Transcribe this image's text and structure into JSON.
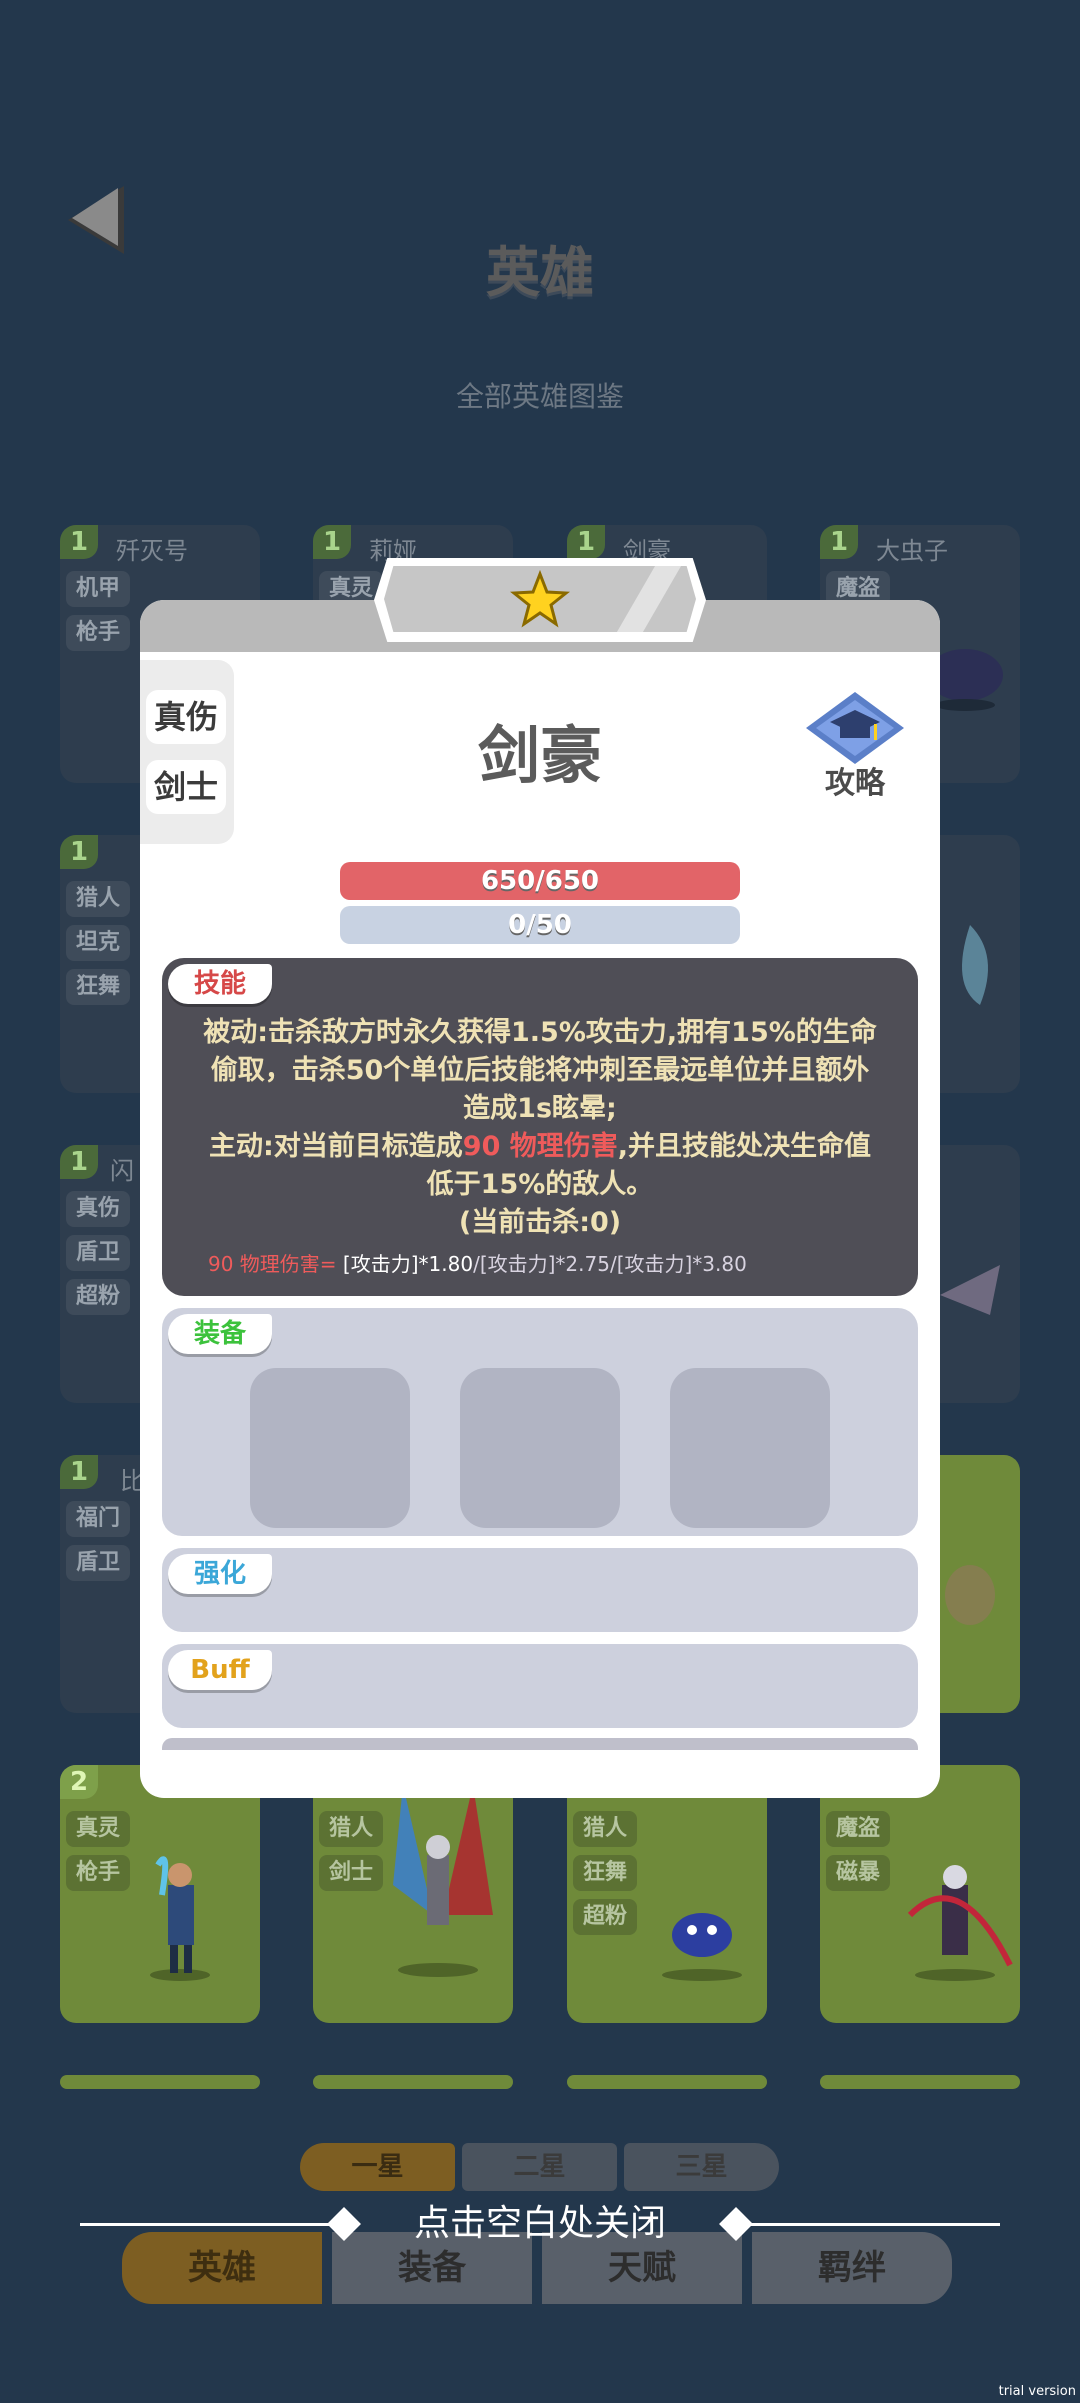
{
  "page": {
    "title": "英雄",
    "subtitle": "全部英雄图鉴"
  },
  "heroes_top": [
    {
      "level": "1",
      "name": "歼灭号",
      "tags": [
        "机甲",
        "枪手"
      ]
    },
    {
      "level": "1",
      "name": "莉娅",
      "tags": [
        "真灵"
      ]
    },
    {
      "level": "1",
      "name": "剑豪",
      "tags": []
    },
    {
      "level": "1",
      "name": "大虫子",
      "tags": [
        "魔盗"
      ]
    }
  ],
  "heroes_row2": {
    "level": "1",
    "tags": [
      "猎人",
      "坦克",
      "狂舞"
    ]
  },
  "heroes_row3": {
    "level": "1",
    "name": "闪",
    "tags": [
      "真伤",
      "盾卫",
      "超粉"
    ]
  },
  "heroes_row4": {
    "level": "1",
    "name": "比",
    "tags": [
      "福门",
      "盾卫"
    ]
  },
  "heroes_row5": [
    {
      "level": "2",
      "tags": [
        "真灵",
        "枪手"
      ]
    },
    {
      "tags": [
        "猎人",
        "剑士"
      ]
    },
    {
      "tags": [
        "猎人",
        "狂舞",
        "超粉"
      ]
    },
    {
      "tags": [
        "魔盗",
        "磁暴"
      ]
    }
  ],
  "star_tabs": [
    "一星",
    "二星",
    "三星"
  ],
  "close_hint": "点击空白处关闭",
  "bottom_tabs": [
    "英雄",
    "装备",
    "天赋",
    "羁绊"
  ],
  "watermark": "trial version",
  "modal": {
    "side_tags": [
      "真伤",
      "剑士"
    ],
    "hero_name": "剑豪",
    "guide_label": "攻略",
    "hp": "650/650",
    "exp": "0/50",
    "skill": {
      "label": "技能",
      "text_1": "被动:击杀敌方时永久获得1.5%攻击力,拥有15%的生命偷取，击杀50个单位后技能将冲刺至最远单位并且额外造成1s眩晕;",
      "text_2a": "主动:对当前目标造成",
      "text_2_dmg": "90 物理伤害",
      "text_2b": ",并且技能处决生命值低于15%的敌人。",
      "text_3": "(当前击杀:0)",
      "formula_red": "90 物理伤害=",
      "formula_bright": " [攻击力]*1.80",
      "formula_rest": "/[攻击力]*2.75/[攻击力]*3.80"
    },
    "equip_label": "装备",
    "enhance_label": "强化",
    "buff_label": "Buff"
  },
  "colors": {
    "background": "#23374c",
    "accent_gold": "#7d5e22",
    "hp_red": "#e26468",
    "skill_panel": "#4f4e56",
    "label_equip": "#3cc23c",
    "label_enhance": "#3ba7d8",
    "label_buff": "#e2a21c",
    "label_skill": "#d64848"
  }
}
